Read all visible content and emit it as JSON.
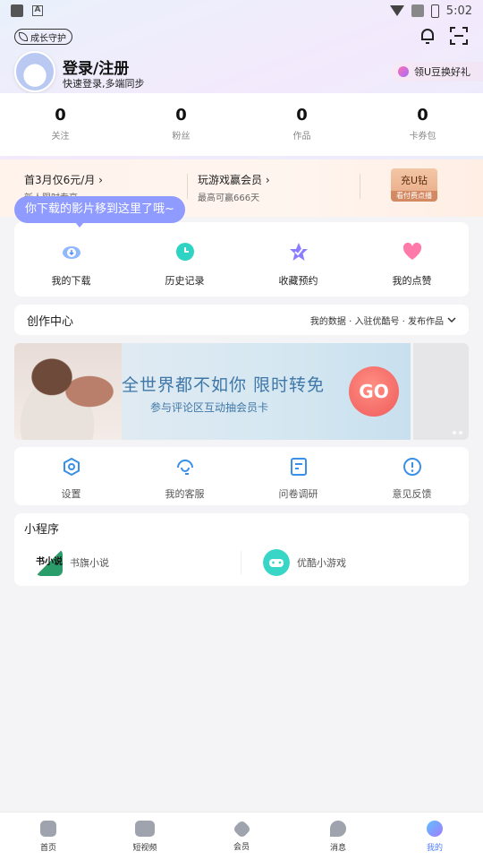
{
  "status_bar": {
    "time": "5:02",
    "a_icon_text": "A"
  },
  "header": {
    "growth_badge": "成长守护",
    "login_title": "登录/注册",
    "login_sub": "快速登录,多端同步",
    "redeem_label": "领U豆换好礼"
  },
  "stats": [
    {
      "value": "0",
      "label": "关注"
    },
    {
      "value": "0",
      "label": "粉丝"
    },
    {
      "value": "0",
      "label": "作品"
    },
    {
      "value": "0",
      "label": "卡券包"
    }
  ],
  "vip": {
    "item1_title": "首3月仅6元/月",
    "item1_sub": "新人限时专享",
    "item2_title": "玩游戏赢会员",
    "item2_sub": "最高可赢666天",
    "charge_label": "充U钻",
    "charge_sub": "看付费点播"
  },
  "tooltip": "你下载的影片移到这里了哦~",
  "shortcuts": [
    {
      "label": "我的下载",
      "icon": "download-icon"
    },
    {
      "label": "历史记录",
      "icon": "history-icon"
    },
    {
      "label": "收藏预约",
      "icon": "favorite-icon"
    },
    {
      "label": "我的点赞",
      "icon": "heart-icon"
    }
  ],
  "creation": {
    "title": "创作中心",
    "links": "我的数据 · 入驻优酷号 · 发布作品"
  },
  "banner": {
    "headline": "全世界都不如你 限时转免",
    "subline": "参与评论区互动抽会员卡",
    "go_label": "GO"
  },
  "tools": [
    {
      "label": "设置",
      "icon": "settings-icon"
    },
    {
      "label": "我的客服",
      "icon": "customer-service-icon"
    },
    {
      "label": "问卷调研",
      "icon": "survey-icon"
    },
    {
      "label": "意见反馈",
      "icon": "feedback-icon"
    }
  ],
  "mini_programs": {
    "title": "小程序",
    "items": [
      {
        "label": "书旗小说",
        "icon_text": "书小说"
      },
      {
        "label": "优酷小游戏"
      }
    ]
  },
  "tabs": [
    {
      "label": "首页"
    },
    {
      "label": "短视频"
    },
    {
      "label": "会员"
    },
    {
      "label": "消息"
    },
    {
      "label": "我的",
      "active": true
    }
  ],
  "colors": {
    "accent_blue": "#4f7dff",
    "tooltip": "#8f9bff",
    "banner_text": "#3f77a8",
    "go_button": "#ef5b5a"
  }
}
